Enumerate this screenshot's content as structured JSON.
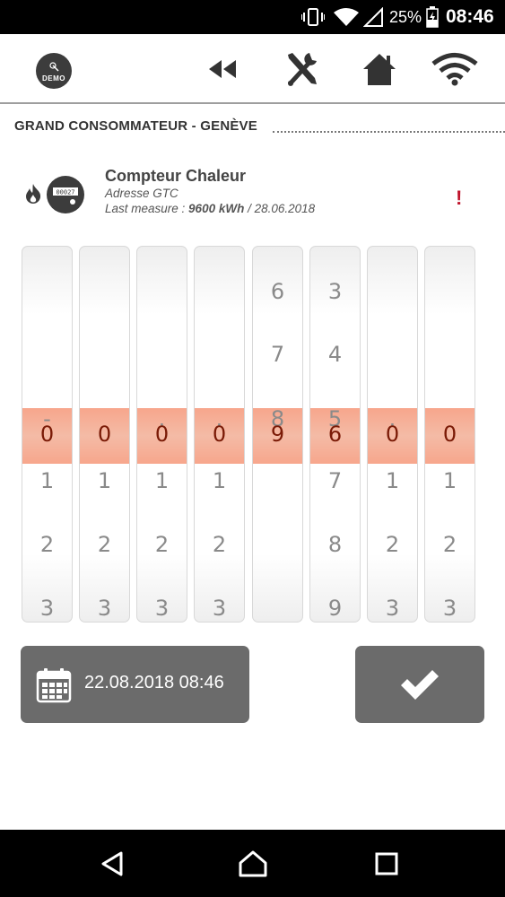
{
  "status_bar": {
    "battery_percent": "25%",
    "time": "08:46",
    "icons": [
      "vibrate-icon",
      "wifi-icon",
      "signal-icon",
      "battery-charging-icon"
    ]
  },
  "toolbar": {
    "demo_label": "DEMO",
    "icons": [
      "back-rewind-icon",
      "tools-icon",
      "home-icon",
      "wifi-icon"
    ]
  },
  "section": {
    "title": "GRAND CONSOMMATEUR - GENÈVE"
  },
  "meter": {
    "name": "Compteur Chaleur",
    "address": "Adresse GTC",
    "last_label": "Last measure : ",
    "last_value": "9600 kWh",
    "last_date": " / 28.06.2018",
    "alert": "!",
    "meter_icon_digits": "00027"
  },
  "wheels": [
    {
      "above": [
        "",
        "",
        "-"
      ],
      "selected": "0",
      "below": [
        "1",
        "2",
        "3"
      ]
    },
    {
      "above": [
        "",
        "",
        ""
      ],
      "selected": "0",
      "below": [
        "1",
        "2",
        "3"
      ]
    },
    {
      "above": [
        "",
        "",
        "."
      ],
      "selected": "0",
      "below": [
        "1",
        "2",
        "3"
      ]
    },
    {
      "above": [
        "",
        "",
        "."
      ],
      "selected": "0",
      "below": [
        "1",
        "2",
        "3"
      ]
    },
    {
      "above": [
        "6",
        "7",
        "8"
      ],
      "selected": "9",
      "below": [
        "",
        "",
        ""
      ]
    },
    {
      "above": [
        "3",
        "4",
        "5"
      ],
      "selected": "6",
      "below": [
        "7",
        "8",
        "9"
      ]
    },
    {
      "above": [
        "",
        "",
        "."
      ],
      "selected": "0",
      "below": [
        "1",
        "2",
        "3"
      ]
    },
    {
      "above": [
        "",
        "",
        ""
      ],
      "selected": "0",
      "below": [
        "1",
        "2",
        "3"
      ]
    }
  ],
  "date_button": {
    "label": "22.08.2018 08:46"
  },
  "colors": {
    "accent_band": "#f7a68c",
    "button_bg": "#6b6b6b",
    "alert": "#c0142b"
  }
}
